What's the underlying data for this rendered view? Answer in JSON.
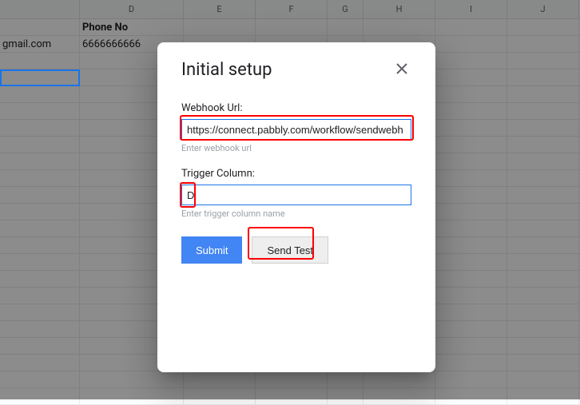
{
  "sheet": {
    "columns": [
      "D",
      "E",
      "F",
      "G",
      "H",
      "I",
      "J"
    ],
    "headerCell": "Phone No",
    "emailPartial": "gmail.com",
    "phone": "6666666666"
  },
  "modal": {
    "title": "Initial setup",
    "webhook": {
      "label": "Webhook Url:",
      "value": "https://connect.pabbly.com/workflow/sendwebh",
      "hint": "Enter webhook url"
    },
    "trigger": {
      "label": "Trigger Column:",
      "value": "D",
      "hint": "Enter trigger column name"
    },
    "buttons": {
      "submit": "Submit",
      "sendTest": "Send Test"
    }
  }
}
